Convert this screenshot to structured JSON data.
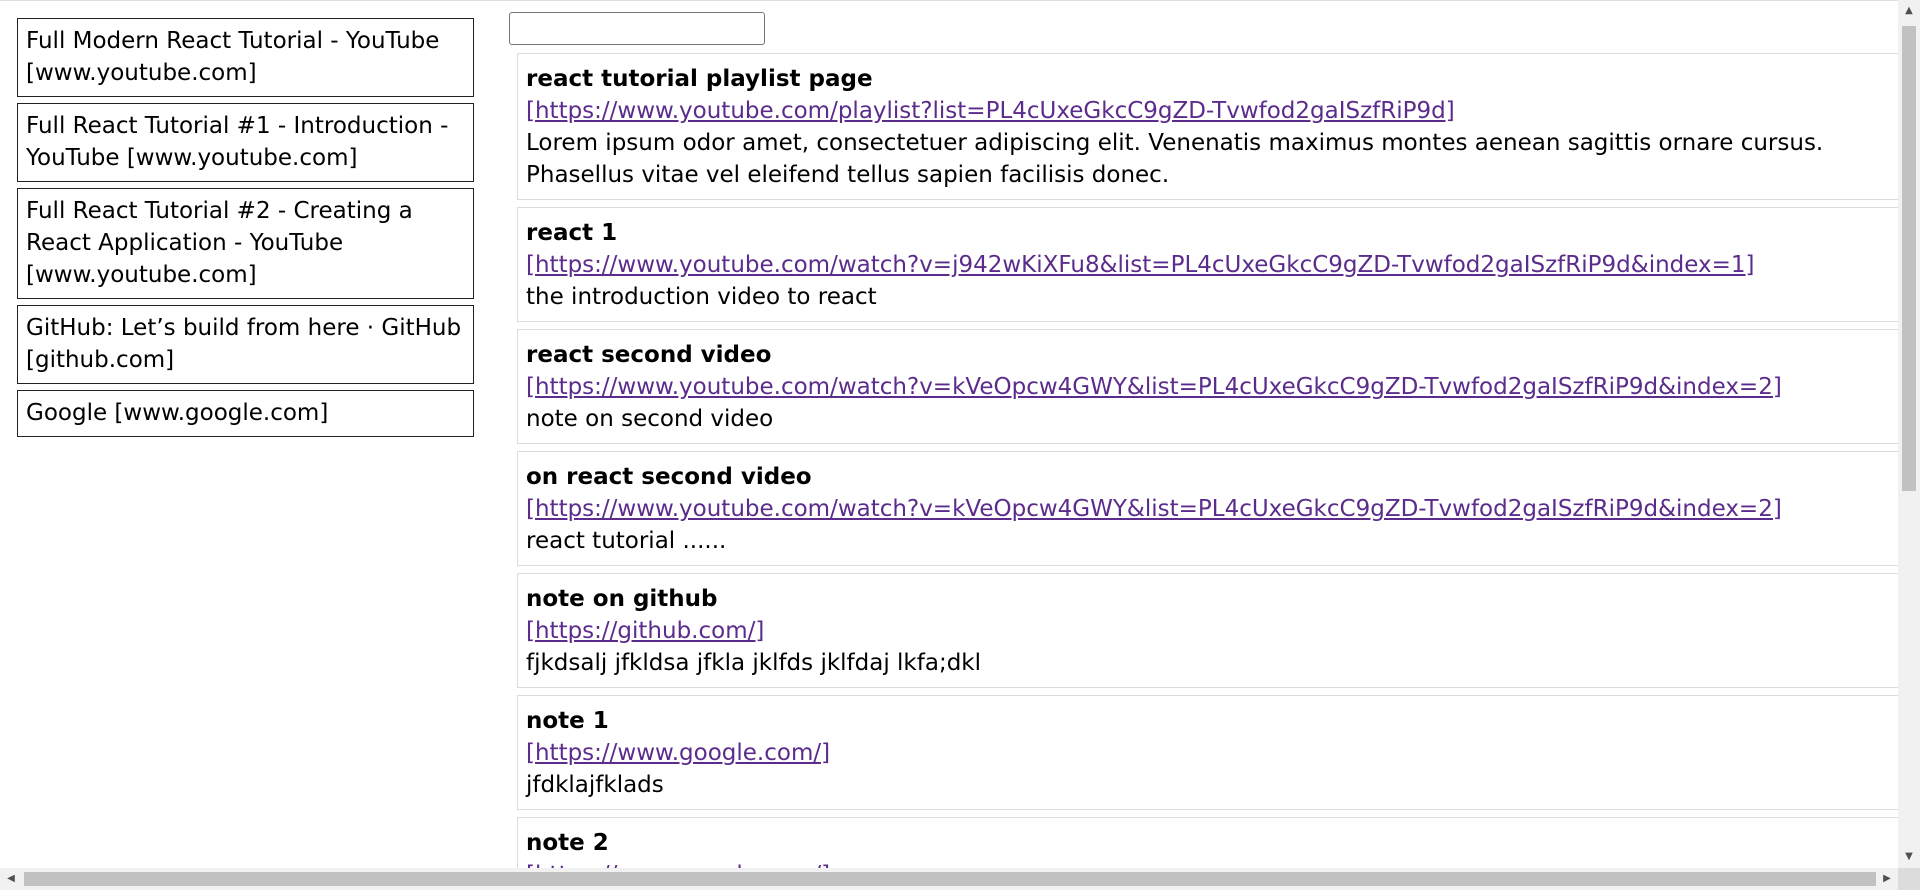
{
  "search": {
    "value": "",
    "placeholder": ""
  },
  "sites": [
    {
      "label": "Full Modern React Tutorial - YouTube [www.youtube.com]"
    },
    {
      "label": "Full React Tutorial #1 - Introduction - YouTube [www.youtube.com]"
    },
    {
      "label": "Full React Tutorial #2 - Creating a React Application - YouTube [www.youtube.com]"
    },
    {
      "label": "GitHub: Let’s build from here · GitHub [github.com]"
    },
    {
      "label": "Google [www.google.com]"
    }
  ],
  "notes": [
    {
      "title": "react tutorial playlist page",
      "link": "[https://www.youtube.com/playlist?list=PL4cUxeGkcC9gZD-Tvwfod2gaISzfRiP9d]",
      "body": "Lorem ipsum odor amet, consectetuer adipiscing elit. Venenatis maximus montes aenean sagittis ornare cursus. Phasellus vitae vel eleifend tellus sapien facilisis donec."
    },
    {
      "title": "react 1",
      "link": "[https://www.youtube.com/watch?v=j942wKiXFu8&list=PL4cUxeGkcC9gZD-Tvwfod2gaISzfRiP9d&index=1]",
      "body": "the introduction video to react"
    },
    {
      "title": "react second video",
      "link": "[https://www.youtube.com/watch?v=kVeOpcw4GWY&list=PL4cUxeGkcC9gZD-Tvwfod2gaISzfRiP9d&index=2]",
      "body": "note on second video"
    },
    {
      "title": "on react second video",
      "link": "[https://www.youtube.com/watch?v=kVeOpcw4GWY&list=PL4cUxeGkcC9gZD-Tvwfod2gaISzfRiP9d&index=2]",
      "body": "react tutorial ......"
    },
    {
      "title": "note on github",
      "link": "[https://github.com/]",
      "body": "fjkdsalj jfkldsa jfkla jklfds jklfdaj lkfa;dkl"
    },
    {
      "title": "note 1",
      "link": "[https://www.google.com/]",
      "body": "jfdklajfklads"
    },
    {
      "title": "note 2",
      "link": "[https://www.google.com/]",
      "body": ""
    }
  ],
  "scrollbars": {
    "up_icon": "arrow-up-icon",
    "down_icon": "arrow-down-icon",
    "left_icon": "arrow-left-icon",
    "right_icon": "arrow-right-icon"
  },
  "colors": {
    "link": "#5b2c8c",
    "card_border": "#222222",
    "note_border": "#dcdcdc"
  }
}
